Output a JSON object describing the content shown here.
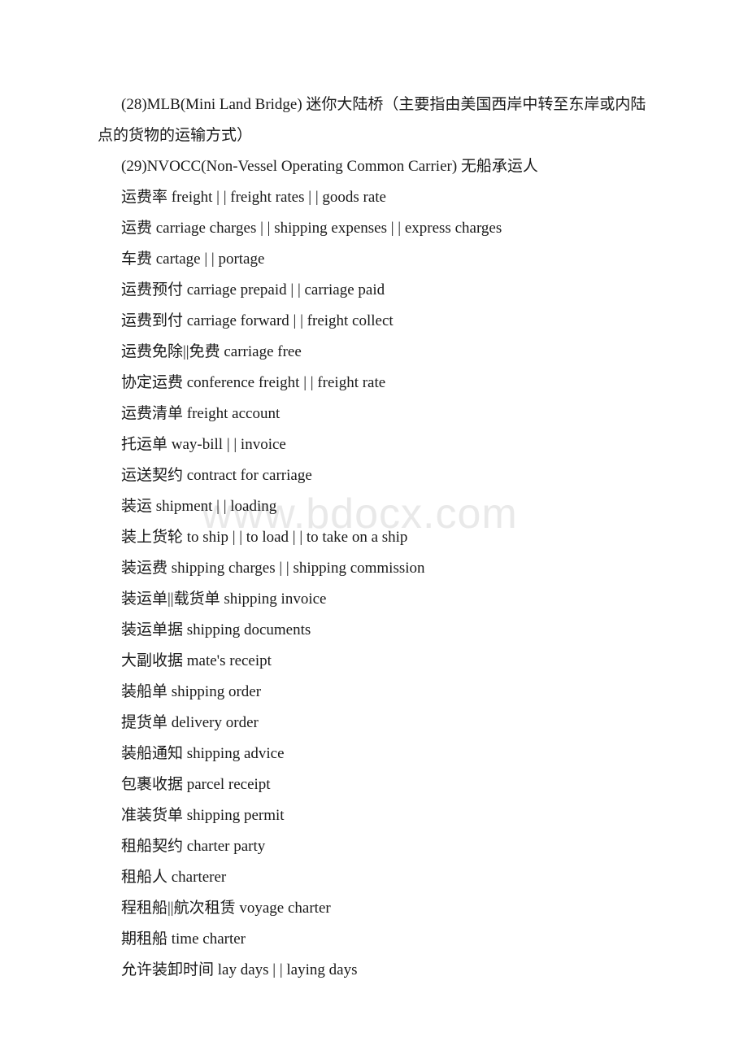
{
  "document": {
    "watermark": "www.bdocx.com",
    "paragraphs": [
      "(28)MLB(Mini Land Bridge) 迷你大陆桥（主要指由美国西岸中转至东岸或内陆点的货物的运输方式）",
      "(29)NVOCC(Non-Vessel Operating Common Carrier) 无船承运人",
      "运费率 freight | | freight rates | | goods rate",
      "运费 carriage charges | | shipping expenses | | express charges",
      "车费 cartage | | portage",
      "运费预付 carriage prepaid | | carriage paid",
      "运费到付 carriage forward | | freight collect",
      "运费免除||免费 carriage free",
      "协定运费 conference freight | | freight rate",
      "运费清单 freight account",
      "托运单 way-bill | | invoice",
      "运送契约 contract for carriage",
      "装运 shipment | | loading",
      "装上货轮 to ship | | to load | | to take on a ship",
      "装运费 shipping charges | | shipping commission",
      "装运单||载货单 shipping invoice",
      "装运单据 shipping documents",
      "大副收据 mate's receipt",
      "装船单 shipping order",
      "提货单 delivery order",
      "装船通知 shipping advice",
      "包裹收据 parcel receipt",
      "准装货单 shipping permit",
      "租船契约 charter party",
      "租船人 charterer",
      "程租船||航次租赁 voyage charter",
      "期租船 time charter",
      "允许装卸时间 lay days | | laying days"
    ]
  }
}
